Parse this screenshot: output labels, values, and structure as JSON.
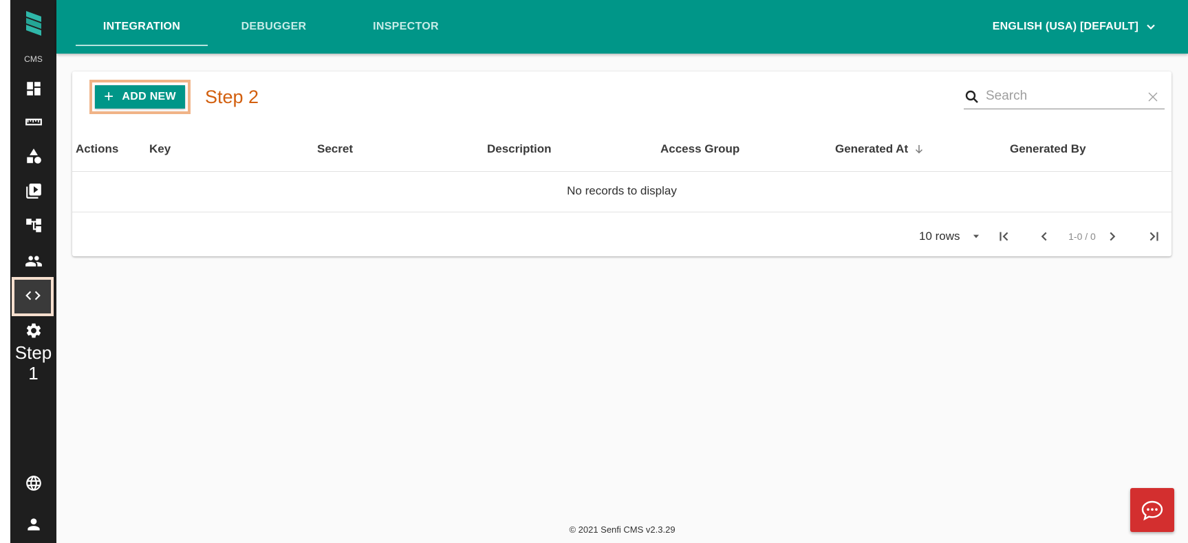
{
  "app": {
    "brand_label": "CMS"
  },
  "sidebar": {
    "items": [
      {
        "name": "dashboard",
        "icon": "dashboard-icon"
      },
      {
        "name": "ruler",
        "icon": "ruler-icon"
      },
      {
        "name": "shapes",
        "icon": "shapes-icon"
      },
      {
        "name": "media",
        "icon": "media-library-icon"
      },
      {
        "name": "structure",
        "icon": "site-tree-icon"
      },
      {
        "name": "users",
        "icon": "people-icon"
      },
      {
        "name": "integration",
        "icon": "code-icon",
        "active": true
      },
      {
        "name": "settings",
        "icon": "gear-icon"
      }
    ],
    "bottom": [
      {
        "name": "language",
        "icon": "globe-icon"
      },
      {
        "name": "profile",
        "icon": "user-icon"
      }
    ],
    "annotation": {
      "line1": "Step",
      "line2": "1"
    }
  },
  "topbar": {
    "tabs": [
      {
        "label": "INTEGRATION",
        "active": true
      },
      {
        "label": "DEBUGGER",
        "active": false
      },
      {
        "label": "INSPECTOR",
        "active": false
      }
    ],
    "language": "ENGLISH (USA) [DEFAULT]"
  },
  "toolbar": {
    "add_label": "ADD NEW",
    "annotation": "Step 2",
    "search_placeholder": "Search"
  },
  "table": {
    "columns": [
      "Actions",
      "Key",
      "Secret",
      "Description",
      "Access Group",
      "Generated At",
      "Generated By"
    ],
    "sorted_column": "Generated At",
    "sort_direction": "descending",
    "empty_message": "No records to display"
  },
  "pagination": {
    "rows_per_page": "10 rows",
    "range": "1-0 / 0"
  },
  "footer": {
    "copyright": "© 2021 Senfi CMS v2.3.29"
  },
  "colors": {
    "primary": "#009688",
    "sidebar_bg": "#1e1e1e",
    "annotation_orange": "#d25f0e",
    "chat_red": "#d32f2f"
  }
}
